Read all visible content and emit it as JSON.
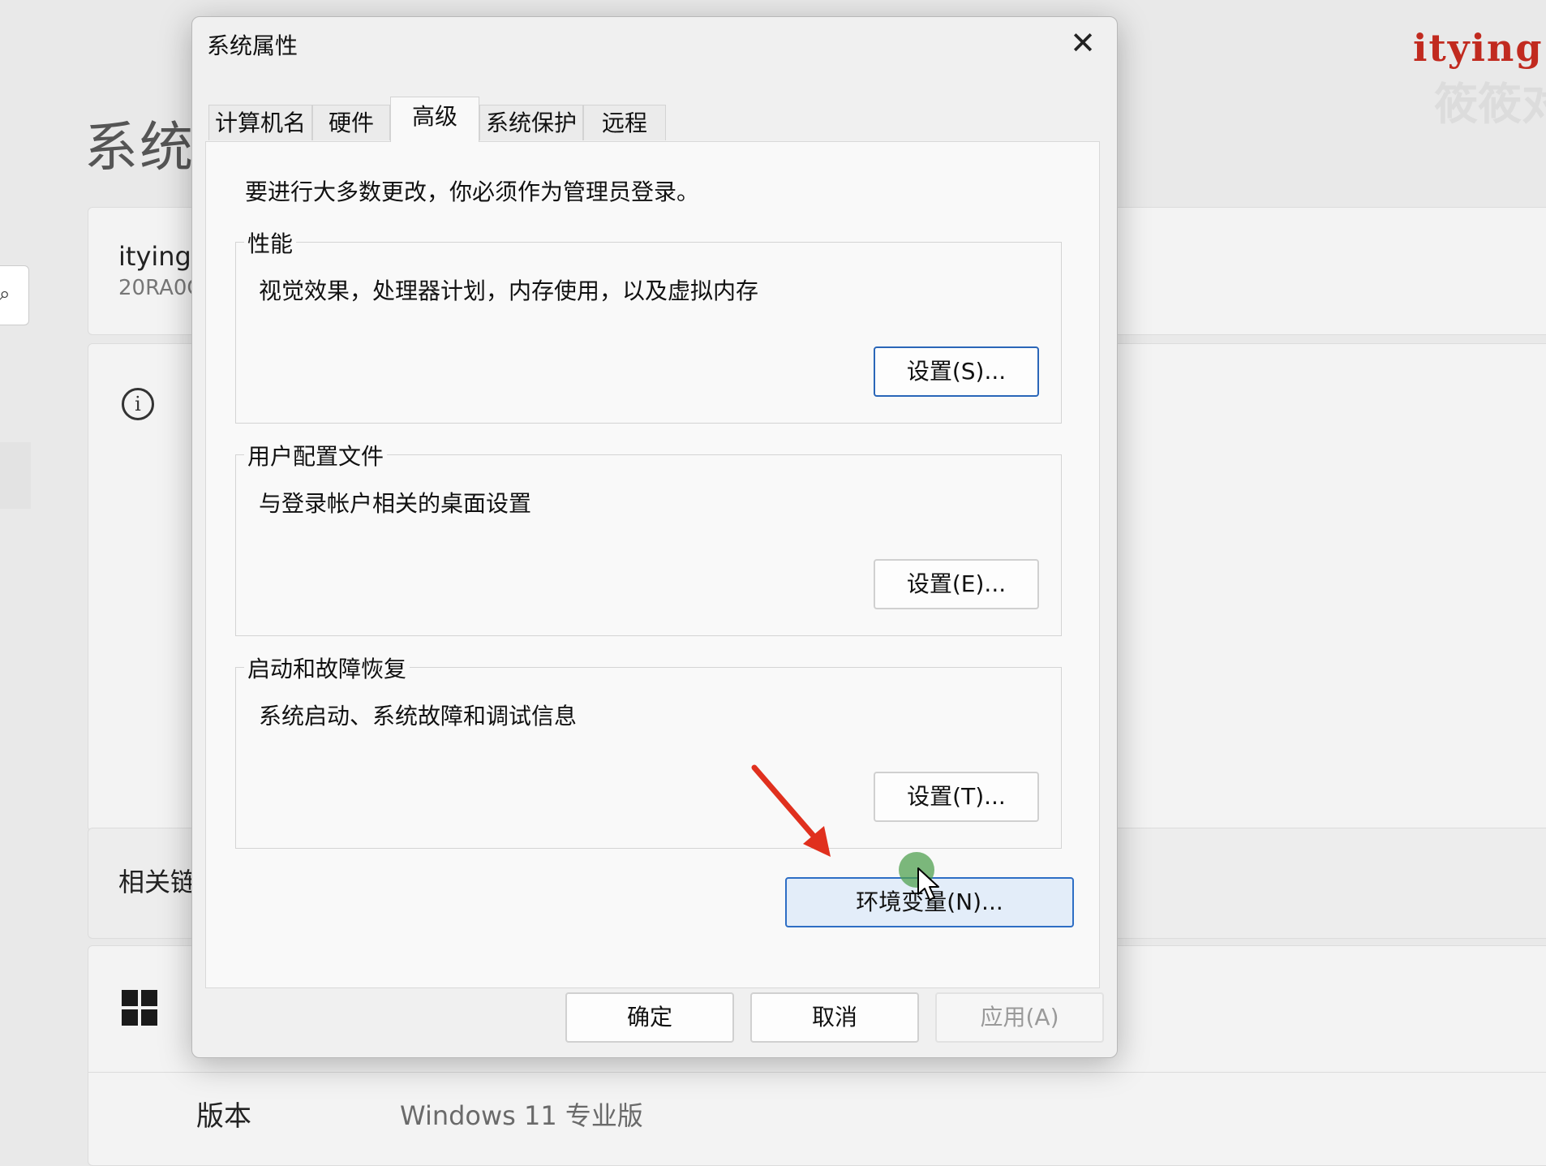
{
  "background": {
    "page_title": "系统",
    "pc_name": "itying",
    "pc_model": "20RA0C",
    "info_icon": "info-icon",
    "related_label": "相关链",
    "edition_label": "版本",
    "edition_value": "Windows 11 专业版",
    "watermark": "itying.",
    "watermark_sub": "筱筱对"
  },
  "dialog": {
    "title": "系统属性",
    "close_glyph": "✕",
    "tabs": [
      {
        "label": "计算机名",
        "active": false
      },
      {
        "label": "硬件",
        "active": false
      },
      {
        "label": "高级",
        "active": true
      },
      {
        "label": "系统保护",
        "active": false
      },
      {
        "label": "远程",
        "active": false
      }
    ],
    "admin_note": "要进行大多数更改，你必须作为管理员登录。",
    "groups": [
      {
        "legend": "性能",
        "description": "视觉效果，处理器计划，内存使用，以及虚拟内存",
        "button": "设置(S)..."
      },
      {
        "legend": "用户配置文件",
        "description": "与登录帐户相关的桌面设置",
        "button": "设置(E)..."
      },
      {
        "legend": "启动和故障恢复",
        "description": "系统启动、系统故障和调试信息",
        "button": "设置(T)..."
      }
    ],
    "env_button": "环境变量(N)...",
    "footer": {
      "ok": "确定",
      "cancel": "取消",
      "apply": "应用(A)"
    }
  },
  "colors": {
    "accent_border": "#2e6ec5",
    "annotation_arrow": "#e0301e",
    "watermark": "#c12a1f"
  }
}
